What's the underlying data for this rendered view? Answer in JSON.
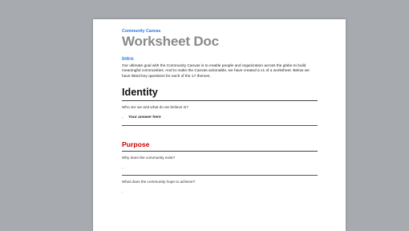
{
  "document": {
    "brand": "Community Canvas",
    "title": "Worksheet Doc",
    "intro": {
      "heading": "Intro",
      "text": "Our ultimate goal with the Community Canvas is to enable people and organization across the globe to build meaningful communities. And to make the Canvas actionable, we have created a v1 of a worksheet. Below we have listed key questions for each of the 17 themes."
    },
    "sections": {
      "identity": {
        "title": "Identity",
        "questions": [
          {
            "text": "Who are we and what do we believe in?",
            "answer": "Your answer here"
          }
        ]
      },
      "purpose": {
        "title": "Purpose",
        "questions": [
          {
            "text": "Why does the community exist?",
            "answer": ""
          },
          {
            "text": "What does the community hope to achieve?",
            "answer": ""
          }
        ]
      }
    },
    "bullet_glyph": "›"
  },
  "colors": {
    "background": "#a7aaae",
    "page": "#ffffff",
    "brand": "#2b78e4",
    "title": "#8a8a8a",
    "purpose_title": "#cc0000"
  }
}
